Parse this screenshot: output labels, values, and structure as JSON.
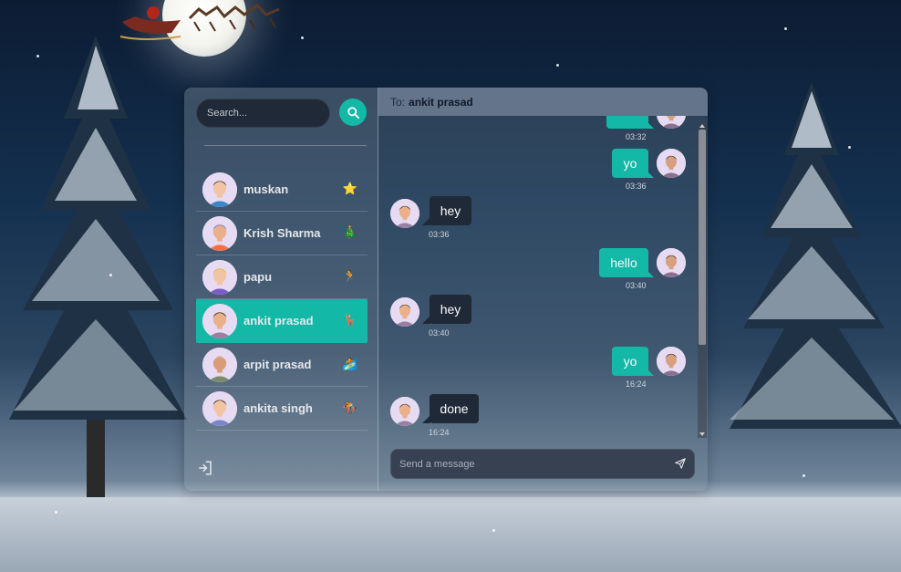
{
  "search": {
    "placeholder": "Search..."
  },
  "conversations": [
    {
      "name": "muskan",
      "emoji": "⭐",
      "skin": "#f1c4a4",
      "hair": "#2a2a2a",
      "shirt": "#3a86c9"
    },
    {
      "name": "Krish Sharma",
      "emoji": "🎄",
      "skin": "#e9b08a",
      "hair": "#5b6ee8",
      "shirt": "#f56f45"
    },
    {
      "name": "papu",
      "emoji": "🏃",
      "skin": "#f1c4a4",
      "hair": "#e0b13c",
      "shirt": "#7c5cc9"
    },
    {
      "name": "ankit prasad",
      "emoji": "🦌",
      "skin": "#e9b08a",
      "hair": "#1e1e1e",
      "shirt": "#9a7fa0"
    },
    {
      "name": "arpit prasad",
      "emoji": "🏄",
      "skin": "#d99c7a",
      "hair": "#e6e6e6",
      "shirt": "#7d8a6a"
    },
    {
      "name": "ankita singh",
      "emoji": "🏇",
      "skin": "#f1c4a4",
      "hair": "#1e1e1e",
      "shirt": "#7a86c9"
    }
  ],
  "active_index": 3,
  "chat": {
    "to_label": "To:",
    "to_name": "ankit prasad",
    "messages": [
      {
        "dir": "out",
        "text": "",
        "time": "03:32"
      },
      {
        "dir": "out",
        "text": "yo",
        "time": "03:36"
      },
      {
        "dir": "in",
        "text": "hey",
        "time": "03:36"
      },
      {
        "dir": "out",
        "text": "hello",
        "time": "03:40"
      },
      {
        "dir": "in",
        "text": "hey",
        "time": "03:40"
      },
      {
        "dir": "out",
        "text": "yo",
        "time": "16:24"
      },
      {
        "dir": "in",
        "text": "done",
        "time": "16:24"
      }
    ],
    "composer_placeholder": "Send a message"
  },
  "colors": {
    "accent": "#14b8a6",
    "incoming_bubble": "#1f2937",
    "header": "#64748b"
  },
  "icons": {
    "search": "search-icon",
    "send": "send-icon",
    "logout": "logout-icon"
  }
}
